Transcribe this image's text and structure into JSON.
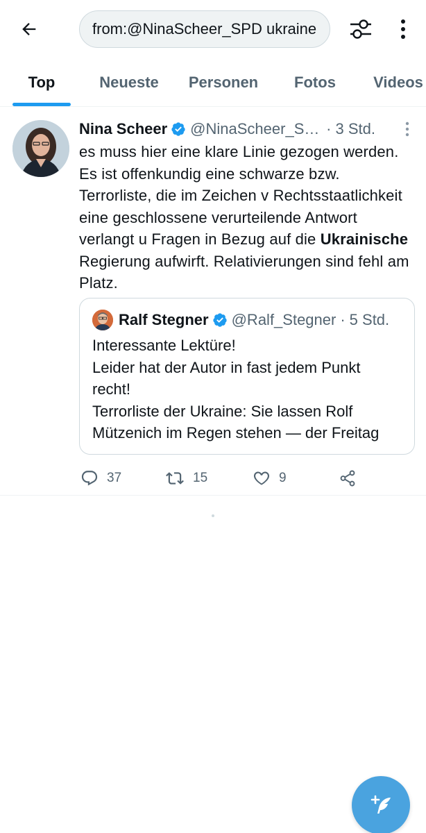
{
  "header": {
    "search_value": "from:@NinaScheer_SPD ukraine",
    "back_icon": "arrow-left-icon",
    "filter_icon": "sliders-icon",
    "more_icon": "vertical-dots-icon"
  },
  "tabs": [
    {
      "label": "Top",
      "active": true
    },
    {
      "label": "Neueste",
      "active": false
    },
    {
      "label": "Personen",
      "active": false
    },
    {
      "label": "Fotos",
      "active": false
    },
    {
      "label": "Videos",
      "active": false
    }
  ],
  "tweet": {
    "author": "Nina Scheer",
    "handle": "@NinaScheer_SPD",
    "separator": "·",
    "time": "3 Std.",
    "text_before": "es muss hier eine klare Linie gezogen werden. Es ist offenkundig eine schwarze bzw. Terrorliste, die im Zeichen v Rechtsstaatlichkeit eine geschlossene verurteilende Antwort verlangt u Fragen in Bezug auf die ",
    "text_bold": "Ukrainische",
    "text_after": " Regierung aufwirft. Relativierungen sind fehl am Platz.",
    "quote": {
      "author": "Ralf Stegner",
      "handle": "@Ralf_Stegner",
      "separator": "·",
      "time": "5 Std.",
      "lines": [
        "Interessante Lektüre!",
        "Leider hat der Autor in fast jedem Punkt",
        "recht!",
        "Terrorliste der Ukraine: Sie lassen Rolf",
        "Mützenich im Regen stehen — der Freitag"
      ]
    },
    "actions": {
      "replies": "37",
      "retweets": "15",
      "likes": "9"
    }
  },
  "colors": {
    "accent": "#1d9bf0",
    "fab": "#4aa3df",
    "text": "#0f1419",
    "secondary": "#536471"
  }
}
